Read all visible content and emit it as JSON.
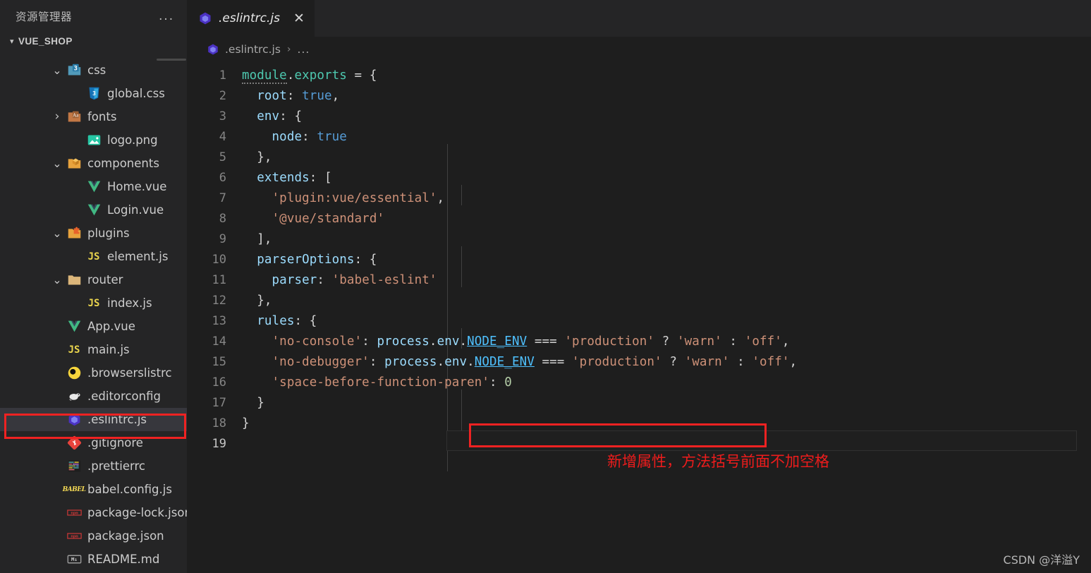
{
  "sidebar": {
    "header_title": "资源管理器",
    "more_actions": "...",
    "root_label": "VUE_SHOP",
    "root_expanded": true,
    "items": [
      {
        "label": "css",
        "icon": "folder-css-icon",
        "indent": 2,
        "type": "folder",
        "expanded": true,
        "chevron": "v"
      },
      {
        "label": "global.css",
        "icon": "css3-file-icon",
        "indent": 3,
        "type": "file",
        "expanded": false,
        "chevron": ""
      },
      {
        "label": "fonts",
        "icon": "folder-fonts-icon",
        "indent": 2,
        "type": "folder",
        "expanded": false,
        "chevron": ">"
      },
      {
        "label": "logo.png",
        "icon": "image-file-icon",
        "indent": 3,
        "type": "file",
        "expanded": false,
        "chevron": ""
      },
      {
        "label": "components",
        "icon": "folder-components-icon",
        "indent": 2,
        "type": "folder",
        "expanded": true,
        "chevron": "v"
      },
      {
        "label": "Home.vue",
        "icon": "vue-file-icon",
        "indent": 3,
        "type": "file",
        "expanded": false,
        "chevron": ""
      },
      {
        "label": "Login.vue",
        "icon": "vue-file-icon",
        "indent": 3,
        "type": "file",
        "expanded": false,
        "chevron": ""
      },
      {
        "label": "plugins",
        "icon": "folder-plugins-icon",
        "indent": 2,
        "type": "folder",
        "expanded": true,
        "chevron": "v"
      },
      {
        "label": "element.js",
        "icon": "js-file-icon",
        "indent": 3,
        "type": "file",
        "expanded": false,
        "chevron": ""
      },
      {
        "label": "router",
        "icon": "folder-icon",
        "indent": 2,
        "type": "folder",
        "expanded": true,
        "chevron": "v"
      },
      {
        "label": "index.js",
        "icon": "js-file-icon",
        "indent": 3,
        "type": "file",
        "expanded": false,
        "chevron": ""
      },
      {
        "label": "App.vue",
        "icon": "vue-file-icon",
        "indent": 2,
        "type": "file",
        "expanded": false,
        "chevron": ""
      },
      {
        "label": "main.js",
        "icon": "js-file-icon",
        "indent": 2,
        "type": "file",
        "expanded": false,
        "chevron": ""
      },
      {
        "label": ".browserslistrc",
        "icon": "browserslist-icon",
        "indent": 2,
        "type": "file",
        "expanded": false,
        "chevron": ""
      },
      {
        "label": ".editorconfig",
        "icon": "editorconfig-icon",
        "indent": 2,
        "type": "file",
        "expanded": false,
        "chevron": ""
      },
      {
        "label": ".eslintrc.js",
        "icon": "eslint-icon",
        "indent": 2,
        "type": "file",
        "expanded": false,
        "chevron": "",
        "selected": true,
        "highlighted": true
      },
      {
        "label": ".gitignore",
        "icon": "git-icon",
        "indent": 2,
        "type": "file",
        "expanded": false,
        "chevron": ""
      },
      {
        "label": ".prettierrc",
        "icon": "prettier-icon",
        "indent": 2,
        "type": "file",
        "expanded": false,
        "chevron": ""
      },
      {
        "label": "babel.config.js",
        "icon": "babel-icon",
        "indent": 2,
        "type": "file",
        "expanded": false,
        "chevron": ""
      },
      {
        "label": "package-lock.json",
        "icon": "npm-icon",
        "indent": 2,
        "type": "file",
        "expanded": false,
        "chevron": ""
      },
      {
        "label": "package.json",
        "icon": "npm-icon",
        "indent": 2,
        "type": "file",
        "expanded": false,
        "chevron": ""
      },
      {
        "label": "README.md",
        "icon": "markdown-icon",
        "indent": 2,
        "type": "file",
        "expanded": false,
        "chevron": ""
      }
    ]
  },
  "tabs": [
    {
      "label": ".eslintrc.js",
      "icon": "eslint-icon",
      "active": true,
      "preview_italic": true,
      "close_glyph": "✕"
    }
  ],
  "breadcrumb": {
    "file_icon": "eslint-icon",
    "file_label": ".eslintrc.js",
    "separator": "›",
    "overflow": "..."
  },
  "editor": {
    "active_line": 19,
    "lines": [
      {
        "n": 1,
        "tokens": [
          {
            "t": "module",
            "c": "def hint"
          },
          {
            "t": ".",
            "c": "pln"
          },
          {
            "t": "exports",
            "c": "def"
          },
          {
            "t": " = ",
            "c": "op"
          },
          {
            "t": "{",
            "c": "pln"
          }
        ]
      },
      {
        "n": 2,
        "tokens": [
          {
            "t": "  ",
            "c": "pln"
          },
          {
            "t": "root",
            "c": "prop"
          },
          {
            "t": ": ",
            "c": "pln"
          },
          {
            "t": "true",
            "c": "kw"
          },
          {
            "t": ",",
            "c": "pln"
          }
        ]
      },
      {
        "n": 3,
        "tokens": [
          {
            "t": "  ",
            "c": "pln"
          },
          {
            "t": "env",
            "c": "prop"
          },
          {
            "t": ": ",
            "c": "pln"
          },
          {
            "t": "{",
            "c": "pln"
          }
        ]
      },
      {
        "n": 4,
        "tokens": [
          {
            "t": "    ",
            "c": "pln"
          },
          {
            "t": "node",
            "c": "prop"
          },
          {
            "t": ": ",
            "c": "pln"
          },
          {
            "t": "true",
            "c": "kw"
          }
        ]
      },
      {
        "n": 5,
        "tokens": [
          {
            "t": "  ",
            "c": "pln"
          },
          {
            "t": "},",
            "c": "pln"
          }
        ]
      },
      {
        "n": 6,
        "tokens": [
          {
            "t": "  ",
            "c": "pln"
          },
          {
            "t": "extends",
            "c": "prop"
          },
          {
            "t": ": ",
            "c": "pln"
          },
          {
            "t": "[",
            "c": "pln"
          }
        ]
      },
      {
        "n": 7,
        "tokens": [
          {
            "t": "    ",
            "c": "pln"
          },
          {
            "t": "'plugin:vue/essential'",
            "c": "str"
          },
          {
            "t": ",",
            "c": "pln"
          }
        ]
      },
      {
        "n": 8,
        "tokens": [
          {
            "t": "    ",
            "c": "pln"
          },
          {
            "t": "'@vue/standard'",
            "c": "str"
          }
        ]
      },
      {
        "n": 9,
        "tokens": [
          {
            "t": "  ",
            "c": "pln"
          },
          {
            "t": "],",
            "c": "pln"
          }
        ]
      },
      {
        "n": 10,
        "tokens": [
          {
            "t": "  ",
            "c": "pln"
          },
          {
            "t": "parserOptions",
            "c": "prop"
          },
          {
            "t": ": ",
            "c": "pln"
          },
          {
            "t": "{",
            "c": "pln"
          }
        ]
      },
      {
        "n": 11,
        "tokens": [
          {
            "t": "    ",
            "c": "pln"
          },
          {
            "t": "parser",
            "c": "prop"
          },
          {
            "t": ": ",
            "c": "pln"
          },
          {
            "t": "'babel-eslint'",
            "c": "str"
          }
        ]
      },
      {
        "n": 12,
        "tokens": [
          {
            "t": "  ",
            "c": "pln"
          },
          {
            "t": "},",
            "c": "pln"
          }
        ]
      },
      {
        "n": 13,
        "tokens": [
          {
            "t": "  ",
            "c": "pln"
          },
          {
            "t": "rules",
            "c": "prop"
          },
          {
            "t": ": ",
            "c": "pln"
          },
          {
            "t": "{",
            "c": "pln"
          }
        ]
      },
      {
        "n": 14,
        "tokens": [
          {
            "t": "    ",
            "c": "pln"
          },
          {
            "t": "'no-console'",
            "c": "str"
          },
          {
            "t": ": ",
            "c": "pln"
          },
          {
            "t": "process",
            "c": "var"
          },
          {
            "t": ".",
            "c": "pln"
          },
          {
            "t": "env",
            "c": "var"
          },
          {
            "t": ".",
            "c": "pln"
          },
          {
            "t": "NODE_ENV",
            "c": "const"
          },
          {
            "t": " === ",
            "c": "op"
          },
          {
            "t": "'production'",
            "c": "str"
          },
          {
            "t": " ? ",
            "c": "op"
          },
          {
            "t": "'warn'",
            "c": "str"
          },
          {
            "t": " : ",
            "c": "op"
          },
          {
            "t": "'off'",
            "c": "str"
          },
          {
            "t": ",",
            "c": "pln"
          }
        ]
      },
      {
        "n": 15,
        "tokens": [
          {
            "t": "    ",
            "c": "pln"
          },
          {
            "t": "'no-debugger'",
            "c": "str"
          },
          {
            "t": ": ",
            "c": "pln"
          },
          {
            "t": "process",
            "c": "var"
          },
          {
            "t": ".",
            "c": "pln"
          },
          {
            "t": "env",
            "c": "var"
          },
          {
            "t": ".",
            "c": "pln"
          },
          {
            "t": "NODE_ENV",
            "c": "const"
          },
          {
            "t": " === ",
            "c": "op"
          },
          {
            "t": "'production'",
            "c": "str"
          },
          {
            "t": " ? ",
            "c": "op"
          },
          {
            "t": "'warn'",
            "c": "str"
          },
          {
            "t": " : ",
            "c": "op"
          },
          {
            "t": "'off'",
            "c": "str"
          },
          {
            "t": ",",
            "c": "pln"
          }
        ]
      },
      {
        "n": 16,
        "tokens": [
          {
            "t": "    ",
            "c": "pln"
          },
          {
            "t": "'space-before-function-paren'",
            "c": "str"
          },
          {
            "t": ": ",
            "c": "pln"
          },
          {
            "t": "0",
            "c": "num"
          }
        ]
      },
      {
        "n": 17,
        "tokens": [
          {
            "t": "  ",
            "c": "pln"
          },
          {
            "t": "}",
            "c": "pln"
          }
        ]
      },
      {
        "n": 18,
        "tokens": [
          {
            "t": "}",
            "c": "pln"
          }
        ]
      },
      {
        "n": 19,
        "tokens": []
      }
    ]
  },
  "annotations": {
    "code_highlight_line": 16,
    "note_text": "新增属性，方法括号前面不加空格",
    "note_color": "#ee1c1c",
    "box_color": "#ef2222"
  },
  "watermark": {
    "text": "CSDN @洋溢Y"
  },
  "colors": {
    "editor_bg": "#1e1e1e",
    "sidebar_bg": "#252526",
    "selection_bg": "#37373d",
    "line_number": "#858585",
    "accent_eslint": "#6633cc"
  }
}
